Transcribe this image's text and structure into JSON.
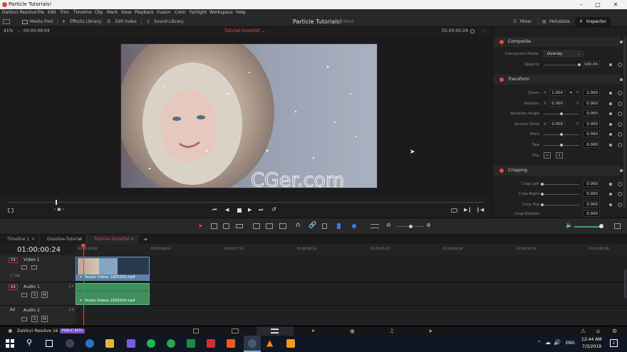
{
  "window": {
    "title": "Particle Tutorials!"
  },
  "menu": [
    "DaVinci Resolve",
    "File",
    "Edit",
    "Trim",
    "Timeline",
    "Clip",
    "Mark",
    "View",
    "Playback",
    "Fusion",
    "Color",
    "Fairlight",
    "Workspace",
    "Help"
  ],
  "toolbar": {
    "media_pool": "Media Pool",
    "effects_library": "Effects Library",
    "edit_index": "Edit Index",
    "sound_library": "Sound Library",
    "project_title": "Particle Tutorials!",
    "project_status": "Edited",
    "mixer": "Mixer",
    "metadata": "Metadata",
    "inspector": "Inspector"
  },
  "viewer": {
    "zoom": "41%",
    "timecode_left": "00:00:09:04",
    "timeline_name": "Tutorial-Snowfall",
    "timecode_right": "01:00:00:24",
    "watermark": "CGer.com"
  },
  "inspector": {
    "composite": {
      "header": "Composite",
      "mode_label": "Composite Mode",
      "mode_value": "Overlay",
      "opacity_label": "Opacity",
      "opacity_value": "100.00"
    },
    "transform": {
      "header": "Transform",
      "zoom_label": "Zoom",
      "zoom_x": "1.000",
      "zoom_y": "1.000",
      "position_label": "Position",
      "position_x": "0.000",
      "position_y": "0.000",
      "rotation_label": "Rotation Angle",
      "rotation_value": "0.000",
      "anchor_label": "Anchor Point",
      "anchor_x": "0.000",
      "anchor_y": "0.000",
      "pitch_label": "Pitch",
      "pitch_value": "0.000",
      "yaw_label": "Yaw",
      "yaw_value": "0.000",
      "flip_label": "Flip",
      "x_letter": "X",
      "y_letter": "Y"
    },
    "cropping": {
      "header": "Cropping",
      "left_label": "Crop Left",
      "left_value": "0.000",
      "right_label": "Crop Right",
      "right_value": "0.000",
      "top_label": "Crop Top",
      "top_value": "0.000",
      "bottom_label": "Crop Bottom",
      "bottom_value": "0.000"
    }
  },
  "timeline_tabs": [
    "Timeline 1",
    "Dissolve-Tutorial",
    "Tutorial-Snowfall"
  ],
  "timeline": {
    "timecode": "01:00:00:24",
    "ruler": [
      "01:00:00:00",
      "01:00:08:24",
      "01:00:17:23",
      "01:00:26:22",
      "01:00:35:21",
      "01:00:44:20",
      "01:00:53:19",
      "01:01:02:18"
    ],
    "tracks": [
      {
        "id": "V1",
        "name": "Video 1",
        "info": "1 Clip",
        "clip": "Pexels Videos 1993209.mp4"
      },
      {
        "id": "A1",
        "name": "Audio 1",
        "level": "2.0",
        "clip": "Pexels Videos 1993209.mp4"
      },
      {
        "id": "A2",
        "name": "Audio 2",
        "level": "2.0"
      }
    ]
  },
  "status": {
    "app": "DaVinci Resolve 16",
    "badge": "PUBLIC BETA"
  },
  "taskbar": {
    "language": "ENG",
    "time": "12:44 AM",
    "date": "7/3/2019",
    "notif": "2"
  },
  "colors": {
    "accent_red": "#e24b3b",
    "video_clip": "#5b82a8",
    "audio_clip": "#3f8f5f",
    "playhead": "#e24b3b"
  }
}
